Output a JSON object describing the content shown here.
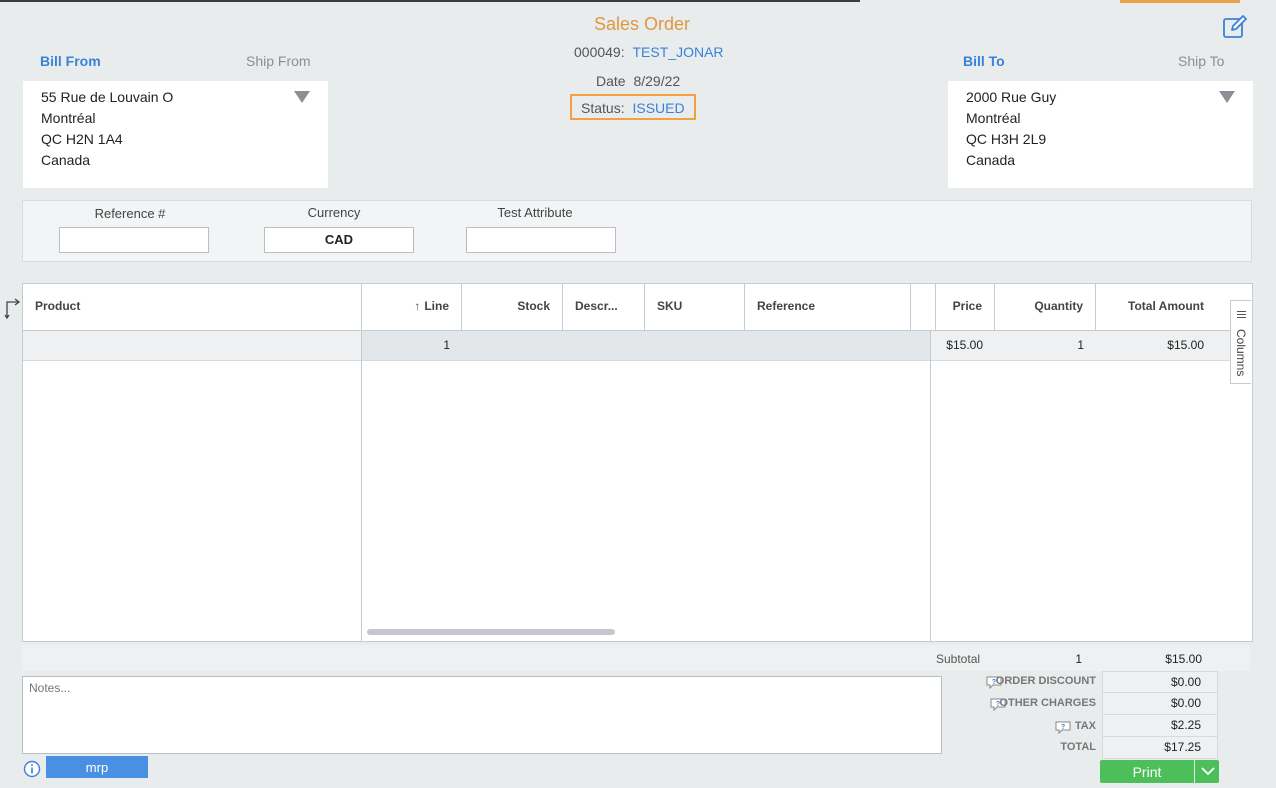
{
  "header": {
    "title": "Sales Order",
    "order_number_label": "000049:",
    "order_number_value": "TEST_JONAR",
    "date_label": "Date",
    "date_value": "8/29/22",
    "status_label": "Status:",
    "status_value": "ISSUED",
    "accent_color": "#e0973d"
  },
  "bill_from": {
    "tab_active": "Bill From",
    "tab_inactive": "Ship From",
    "lines": [
      "55 Rue de Louvain O",
      "Montréal",
      "QC H2N 1A4",
      "Canada"
    ]
  },
  "bill_to": {
    "tab_active": "Bill To",
    "tab_inactive": "Ship To",
    "lines": [
      "2000 Rue Guy",
      "Montréal",
      "QC H3H 2L9",
      "Canada"
    ]
  },
  "fields": {
    "reference_label": "Reference #",
    "reference_value": "",
    "currency_label": "Currency",
    "currency_value": "CAD",
    "test_attr_label": "Test Attribute",
    "test_attr_value": ""
  },
  "grid": {
    "columns": [
      "Product",
      "Line",
      "Stock",
      "Descr...",
      "SKU",
      "Reference",
      "Price",
      "Quantity",
      "Total Amount"
    ],
    "sort_column": "Line",
    "rows": [
      {
        "product": "",
        "line": "1",
        "stock": "",
        "description": "",
        "sku": "",
        "reference": "",
        "price": "$15.00",
        "quantity": "1",
        "total": "$15.00"
      }
    ],
    "columns_tab_label": "Columns"
  },
  "subtotal": {
    "label": "Subtotal",
    "quantity": "1",
    "amount": "$15.00"
  },
  "notes": {
    "placeholder": "Notes...",
    "value": ""
  },
  "totals": {
    "order_discount_label": "ORDER DISCOUNT",
    "order_discount_value": "$0.00",
    "other_charges_label": "OTHER CHARGES",
    "other_charges_value": "$0.00",
    "tax_label": "TAX",
    "tax_value": "$2.25",
    "total_label": "TOTAL",
    "total_value": "$17.25"
  },
  "footer": {
    "mrp_label": "mrp",
    "print_label": "Print",
    "print_color": "#4cbf5a",
    "mrp_color": "#4a90e2"
  },
  "icons": {
    "edit": "edit-icon",
    "info": "info-icon",
    "help": "help-bubble-icon",
    "dropdown": "triangle-down-icon"
  }
}
